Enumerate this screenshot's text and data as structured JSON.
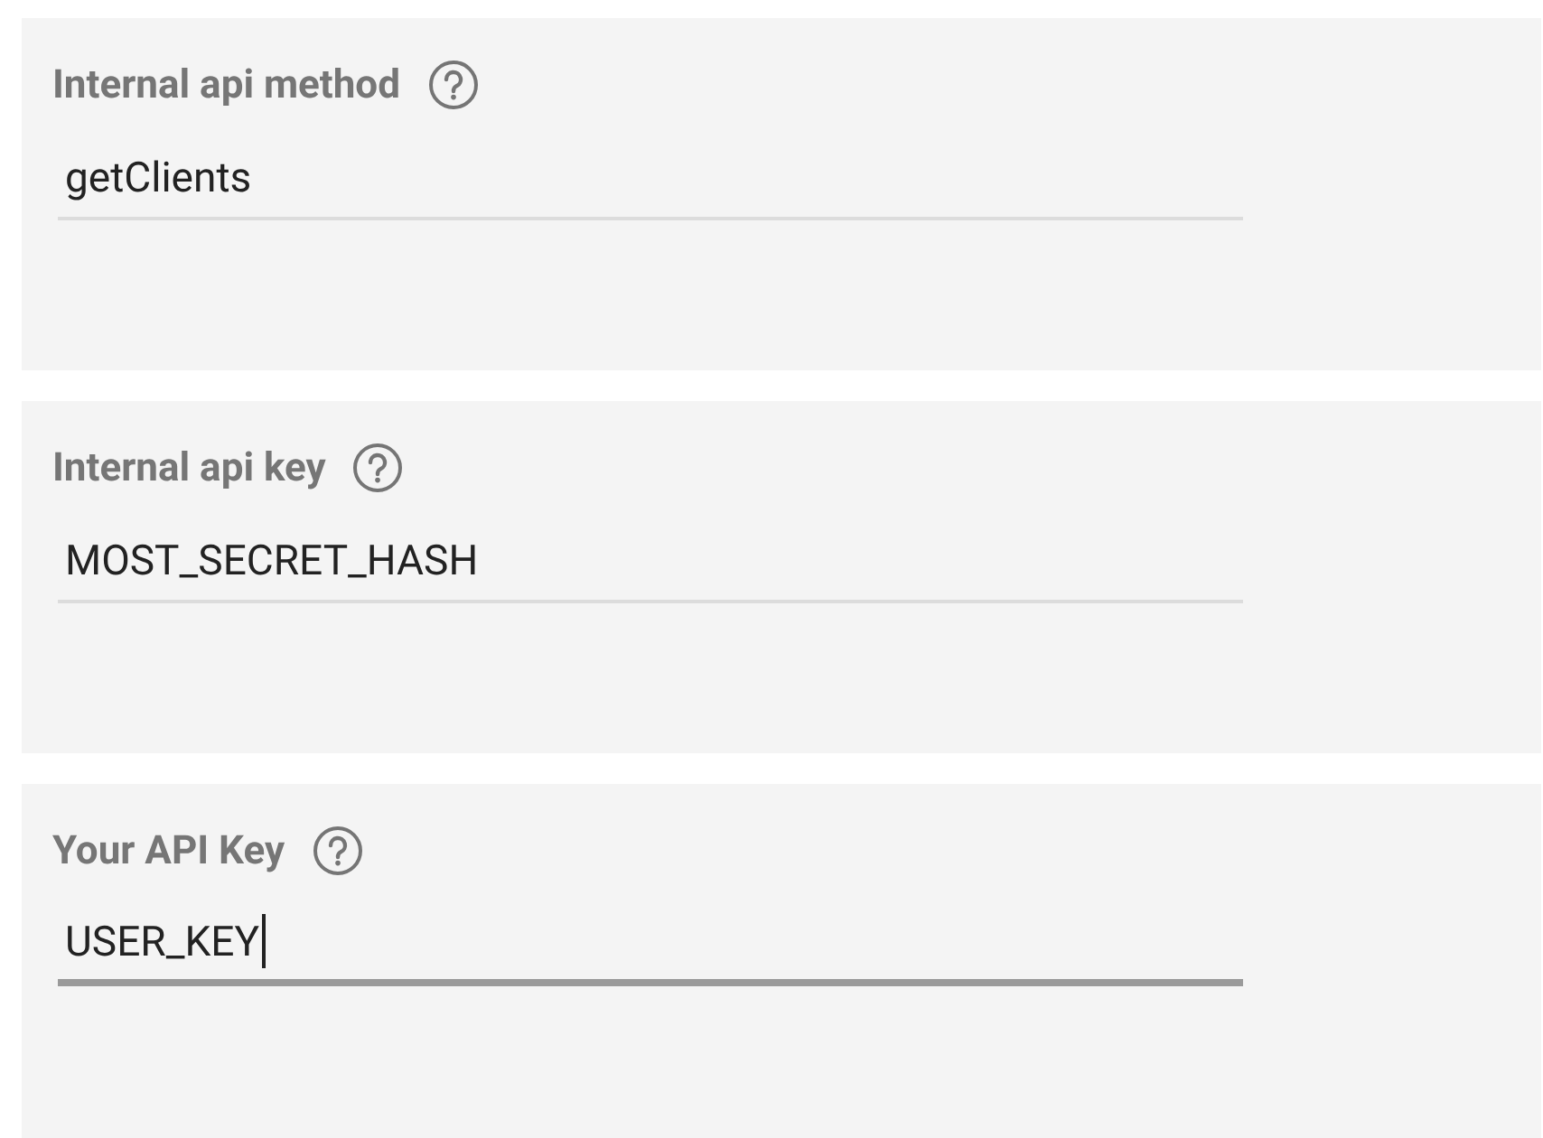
{
  "fields": [
    {
      "label": "Internal api method",
      "value": "getClients",
      "focused": false
    },
    {
      "label": "Internal api key",
      "value": "MOST_SECRET_HASH",
      "focused": false
    },
    {
      "label": "Your API Key",
      "value": "USER_KEY",
      "focused": true
    }
  ]
}
